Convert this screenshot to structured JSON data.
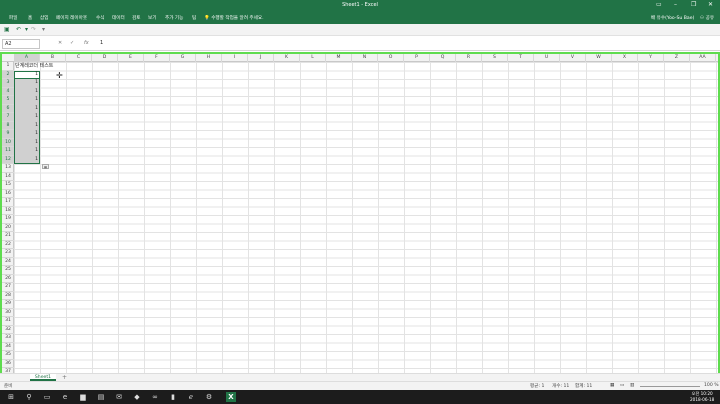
{
  "window": {
    "title": "Sheet1 - Excel"
  },
  "ribbon": {
    "tabs": [
      "파일",
      "홈",
      "삽입",
      "페이지 레이아웃",
      "수식",
      "데이터",
      "검토",
      "보기",
      "추가 기능",
      "팀"
    ],
    "tell_me": "수행할 작업을 알려 주세요.",
    "user": "배 유수(Yoo-Su Bae)",
    "share": "공유"
  },
  "formula_bar": {
    "name_box": "A2",
    "value": "1"
  },
  "grid": {
    "columns": [
      "A",
      "B",
      "C",
      "D",
      "E",
      "F",
      "G",
      "H",
      "I",
      "J",
      "K",
      "L",
      "M",
      "N",
      "O",
      "P",
      "Q",
      "R",
      "S",
      "T",
      "U",
      "V",
      "W",
      "X",
      "Y",
      "Z",
      "AA"
    ],
    "rows": [
      "1",
      "2",
      "3",
      "4",
      "5",
      "6",
      "7",
      "8",
      "9",
      "10",
      "11",
      "12",
      "13",
      "14",
      "15",
      "16",
      "17",
      "18",
      "19",
      "20",
      "21",
      "22",
      "23",
      "24",
      "25",
      "26",
      "27",
      "28",
      "29",
      "30",
      "31",
      "32",
      "33",
      "34",
      "35",
      "36",
      "37"
    ],
    "cell_b1": "단계레코더 테스트",
    "col_a_values": [
      "1",
      "1",
      "1",
      "1",
      "1",
      "1",
      "1",
      "1",
      "1",
      "1",
      "1"
    ]
  },
  "sheet_tabs": {
    "active": "Sheet1",
    "add": "+"
  },
  "status_bar": {
    "ready": "준비",
    "average": "평균: 1",
    "count": "개수: 11",
    "sum": "합계: 11",
    "zoom": "100 %"
  },
  "taskbar": {
    "time": "오전 10:20",
    "date": "2018-06-18"
  }
}
